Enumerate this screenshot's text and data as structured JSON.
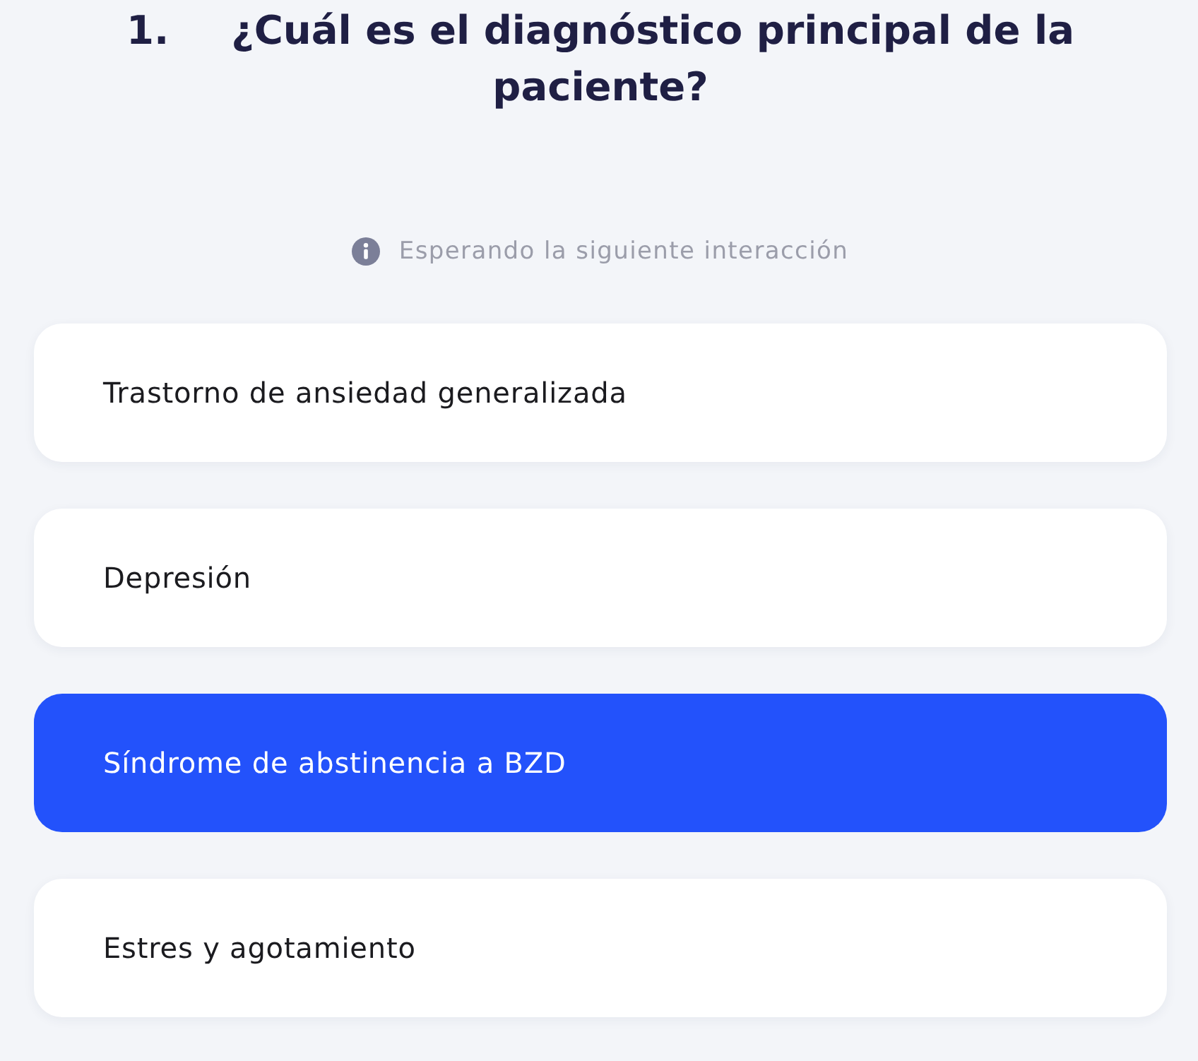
{
  "question": {
    "number": "1.",
    "text": "¿Cuál es el diagnóstico principal de la paciente?"
  },
  "status": {
    "text": "Esperando la siguiente interacción"
  },
  "options": [
    {
      "label": "Trastorno de ansiedad generalizada",
      "selected": false
    },
    {
      "label": "Depresión",
      "selected": false
    },
    {
      "label": "Síndrome de abstinencia a BZD",
      "selected": true
    },
    {
      "label": "Estres y agotamiento",
      "selected": false
    }
  ]
}
